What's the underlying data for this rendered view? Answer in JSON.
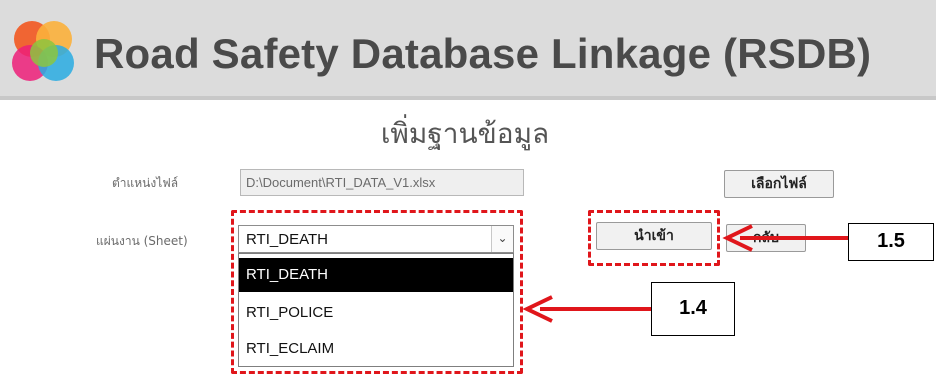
{
  "header": {
    "title": "Road Safety Database Linkage (RSDB)",
    "logo_icon": "colorful-circle-logo-icon"
  },
  "page": {
    "title": "เพิ่มฐานข้อมูล"
  },
  "form": {
    "file_label": "ตำแหน่งไฟล์",
    "file_path": "D:\\Document\\RTI_DATA_V1.xlsx",
    "choose_file_label": "เลือกไฟล์",
    "sheet_label": "แผ่นงาน (Sheet)",
    "sheet_selected": "RTI_DEATH",
    "sheet_options": [
      "RTI_DEATH",
      "RTI_POLICE",
      "RTI_ECLAIM"
    ],
    "import_label": "นำเข้า",
    "back_label": "กลับ"
  },
  "annotations": {
    "callout_dropdown": "1.4",
    "callout_import": "1.5",
    "highlight_color": "#e0161b"
  }
}
